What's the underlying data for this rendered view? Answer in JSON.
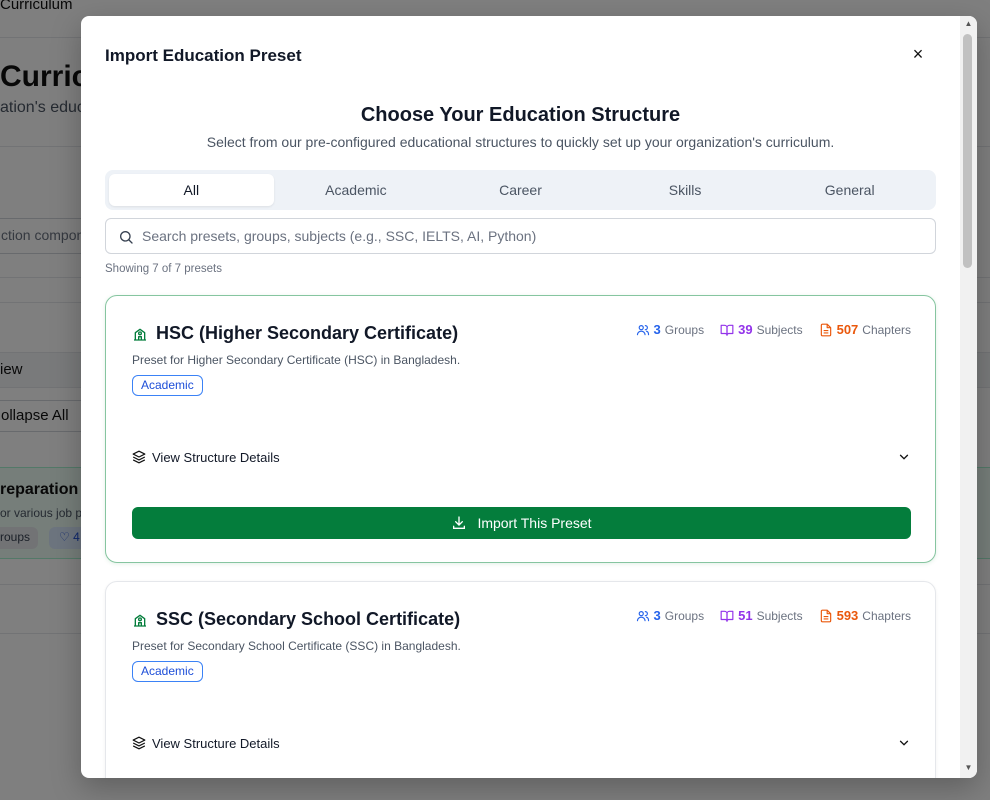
{
  "background": {
    "breadcrumb": "Curriculum",
    "title": "Curric",
    "subtitle": "ation's educ",
    "search_text": "ction compone",
    "view_label": "iew",
    "collapse_label": "ollapse All",
    "card_title": "reparation",
    "card_sub": "or various job p",
    "pill_groups": "roups",
    "pill_count": "4"
  },
  "modal": {
    "title": "Import Education Preset",
    "close_icon": "×",
    "heading": "Choose Your Education Structure",
    "lead": "Select from our pre-configured educational structures to quickly set up your organization's curriculum.",
    "tabs": [
      {
        "label": "All",
        "active": true
      },
      {
        "label": "Academic",
        "active": false
      },
      {
        "label": "Career",
        "active": false
      },
      {
        "label": "Skills",
        "active": false
      },
      {
        "label": "General",
        "active": false
      }
    ],
    "search": {
      "placeholder": "Search presets, groups, subjects (e.g., SSC, IELTS, AI, Python)",
      "value": ""
    },
    "showing": "Showing 7 of 7 presets",
    "presets": [
      {
        "title": "HSC (Higher Secondary Certificate)",
        "description": "Preset for Higher Secondary Certificate (HSC) in Bangladesh.",
        "badge": "Academic",
        "groups": "3",
        "groups_label": "Groups",
        "subjects": "39",
        "subjects_label": "Subjects",
        "chapters": "507",
        "chapters_label": "Chapters",
        "details_label": "View Structure Details",
        "import_label": "Import This Preset"
      },
      {
        "title": "SSC (Secondary School Certificate)",
        "description": "Preset for Secondary School Certificate (SSC) in Bangladesh.",
        "badge": "Academic",
        "groups": "3",
        "groups_label": "Groups",
        "subjects": "51",
        "subjects_label": "Subjects",
        "chapters": "593",
        "chapters_label": "Chapters",
        "details_label": "View Structure Details"
      }
    ]
  },
  "colors": {
    "primary_green": "#047d3c",
    "groups_blue": "#2563eb",
    "subjects_purple": "#9333ea",
    "chapters_orange": "#ea580c",
    "badge_blue": "#1d4ed8"
  },
  "icons": {
    "preset_icon": "school-icon",
    "groups_icon": "users-icon",
    "subjects_icon": "book-open-icon",
    "chapters_icon": "file-text-icon",
    "details_icon": "layers-icon",
    "expand_icon": "chevron-down-icon",
    "import_icon": "download-icon",
    "search_icon": "search-icon"
  }
}
